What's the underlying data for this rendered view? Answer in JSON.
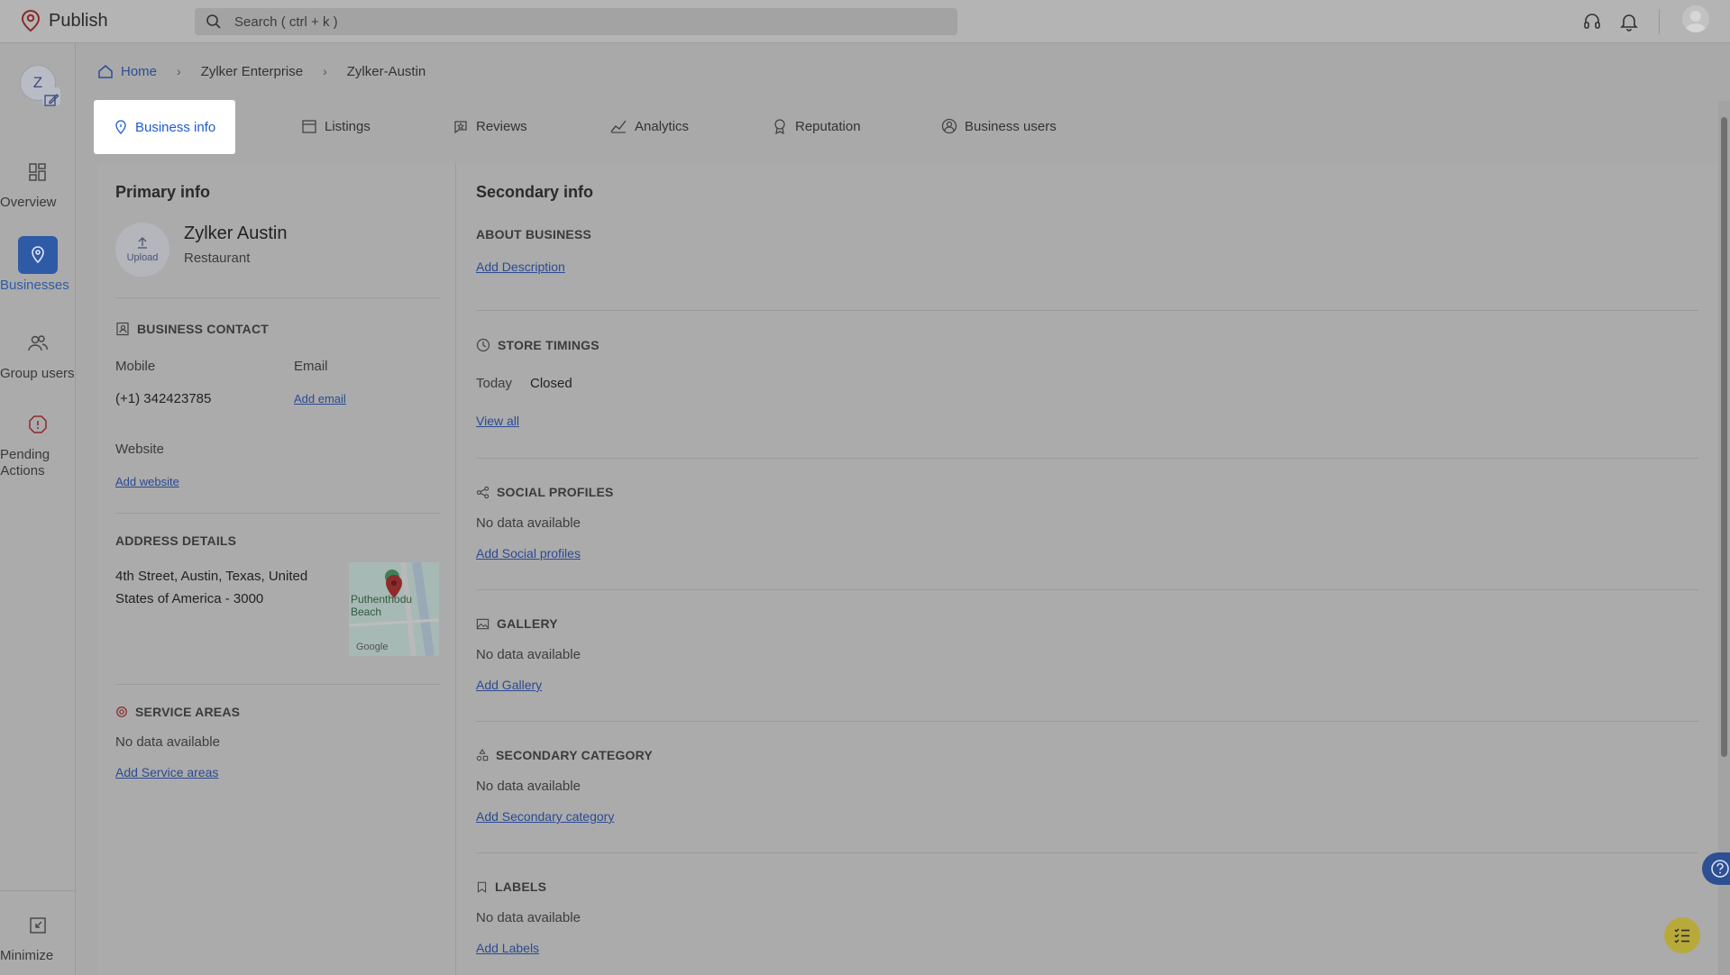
{
  "app": {
    "title": "Publish"
  },
  "search": {
    "placeholder": "Search ( ctrl + k )"
  },
  "rail": {
    "avatar_initial": "Z",
    "items": [
      {
        "label": "Overview",
        "icon": "grid-icon"
      },
      {
        "label": "Businesses",
        "icon": "location-pin-icon",
        "active": true
      },
      {
        "label": "Group users",
        "icon": "users-icon"
      },
      {
        "label": "Pending Actions",
        "icon": "alert-hex-icon"
      }
    ],
    "minimize": "Minimize"
  },
  "breadcrumb": {
    "home": "Home",
    "level1": "Zylker Enterprise",
    "level2": "Zylker-Austin"
  },
  "tabs": [
    "Business info",
    "Listings",
    "Reviews",
    "Analytics",
    "Reputation",
    "Business users"
  ],
  "primary": {
    "title": "Primary info",
    "upload_label": "Upload",
    "business_name": "Zylker Austin",
    "category": "Restaurant",
    "contact_head": "BUSINESS CONTACT",
    "mobile_label": "Mobile",
    "mobile_value": "(+1) 342423785",
    "email_label": "Email",
    "email_link": "Add email",
    "website_label": "Website",
    "website_link": "Add website",
    "address_head": "ADDRESS DETAILS",
    "address_line1": "4th Street, Austin, Texas, United",
    "address_line2": "States of America - 3000",
    "map_label": "Puthenthodu Beach",
    "map_brand": "Google",
    "service_head": "SERVICE AREAS",
    "service_empty": "No data available",
    "service_link": "Add Service areas"
  },
  "secondary": {
    "title": "Secondary info",
    "about_head": "ABOUT BUSINESS",
    "about_link": "Add Description",
    "timings_head": "STORE TIMINGS",
    "today_label": "Today",
    "today_value": "Closed",
    "timings_link": "View all",
    "social_head": "SOCIAL PROFILES",
    "social_empty": "No data available",
    "social_link": "Add Social profiles",
    "gallery_head": "GALLERY",
    "gallery_empty": "No data available",
    "gallery_link": "Add Gallery",
    "seccat_head": "SECONDARY CATEGORY",
    "seccat_empty": "No data available",
    "seccat_link": "Add Secondary category",
    "labels_head": "LABELS",
    "labels_empty": "No data available",
    "labels_link": "Add Labels"
  },
  "colors": {
    "accent": "#1e5bd6",
    "link": "#2b4a93",
    "active_rail": "#2f5aa6",
    "overlay": "#a9a9a9"
  }
}
